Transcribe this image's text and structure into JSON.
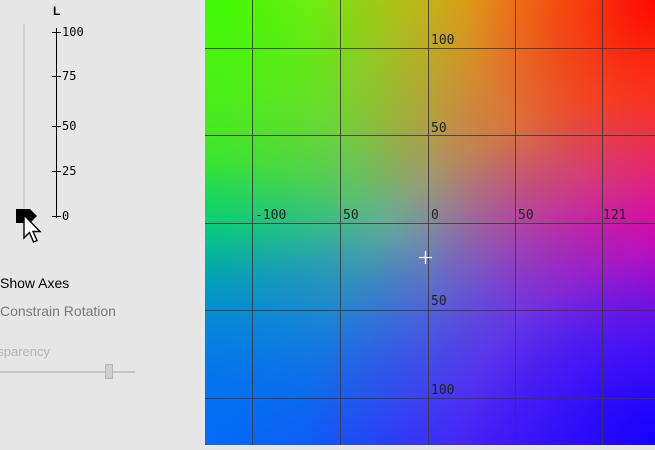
{
  "l_axis": {
    "label": "L",
    "ticks": [
      "100",
      "75",
      "50",
      "25",
      "0"
    ]
  },
  "options": {
    "show_axes": "Show Axes",
    "constrain_rotation": "Constrain Rotation",
    "transparency": "nsparency"
  },
  "plot": {
    "top_labels": [
      "-100",
      "50",
      "0",
      "50",
      "121"
    ],
    "vertical_labels": [
      "100",
      "50",
      "50",
      "100"
    ]
  },
  "colors": {
    "panel_bg": "#e6e6e6",
    "grid": "#3a3a3a",
    "disabled_text": "#7a7a7a"
  }
}
